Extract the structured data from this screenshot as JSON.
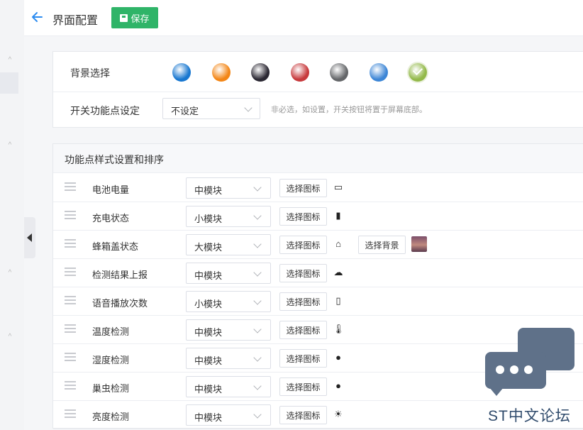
{
  "header": {
    "title": "界面配置",
    "save_label": "保存"
  },
  "config": {
    "bg_label": "背景选择",
    "bg_colors": [
      "#1877d0",
      "#f38616",
      "#2b2833",
      "#c7393c",
      "#646669",
      "#3d86d6",
      "#93b94a"
    ],
    "bg_selected_index": 6,
    "switch_label": "开关功能点设定",
    "switch_value": "不设定",
    "switch_hint": "非必选，如设置，开关按钮将置于屏幕底部。"
  },
  "features": {
    "title": "功能点样式设置和排序",
    "choose_icon_label": "选择图标",
    "choose_bg_label": "选择背景",
    "rows": [
      {
        "name": "电池电量",
        "size": "中模块",
        "icon": "battery-icon"
      },
      {
        "name": "充电状态",
        "size": "小模块",
        "icon": "charging-icon"
      },
      {
        "name": "蜂箱盖状态",
        "size": "大模块",
        "icon": "hive-icon",
        "has_bg": true
      },
      {
        "name": "检测结果上报",
        "size": "中模块",
        "icon": "cloud-upload-icon"
      },
      {
        "name": "语音播放次数",
        "size": "小模块",
        "icon": "count-icon"
      },
      {
        "name": "温度检测",
        "size": "中模块",
        "icon": "thermometer-icon"
      },
      {
        "name": "湿度检测",
        "size": "中模块",
        "icon": "droplet-icon"
      },
      {
        "name": "巢虫检测",
        "size": "中模块",
        "icon": "bug-icon"
      },
      {
        "name": "亮度检测",
        "size": "中模块",
        "icon": "sun-icon"
      }
    ]
  },
  "watermark": {
    "text": "ST中文论坛"
  }
}
